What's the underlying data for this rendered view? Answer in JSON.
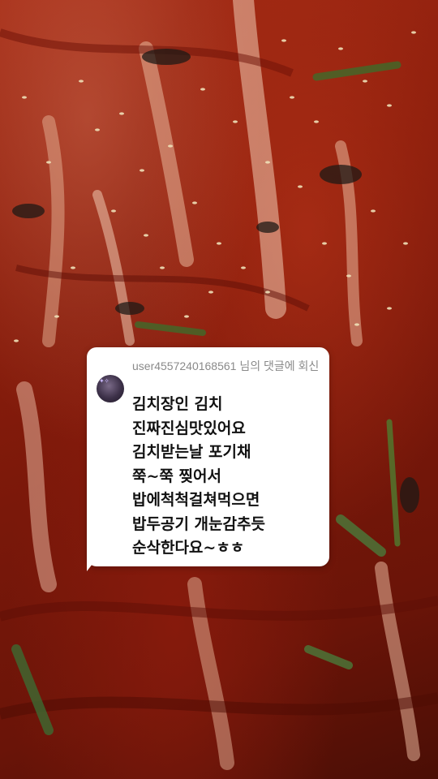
{
  "reply": {
    "header": "user4557240168561 님의 댓글에 회신",
    "lines": [
      "김치장인 김치",
      "진짜진심맛있어요",
      "김치받는날 포기채",
      "쭉~쭉 찢어서",
      "밥에척척걸쳐먹으면",
      "밥두공기 개눈감추듯",
      "순삭한다요~ㅎㅎ"
    ]
  }
}
